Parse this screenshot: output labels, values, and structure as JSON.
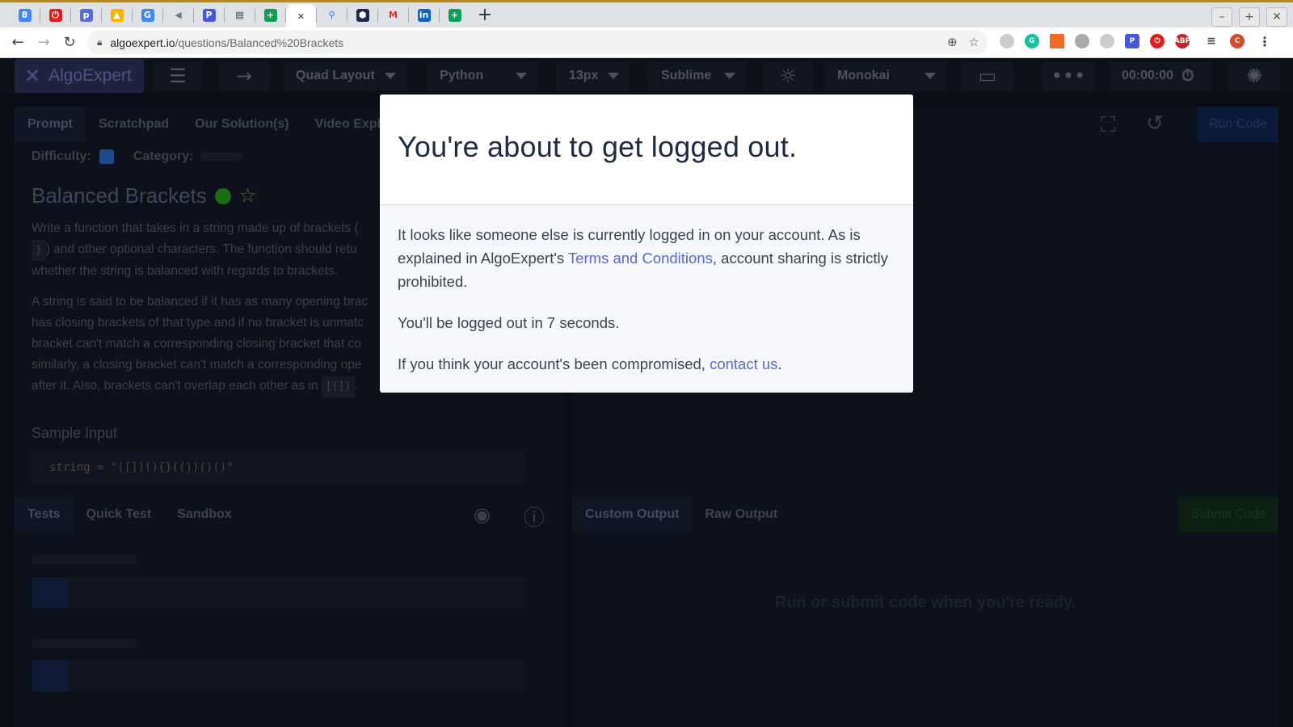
{
  "browser": {
    "tabs": [
      {
        "icon": "calendar-icon",
        "glyph": "8",
        "color": "#4285f4"
      },
      {
        "icon": "opera-icon",
        "glyph": "⏻",
        "color": "#e02020"
      },
      {
        "icon": "p-icon",
        "glyph": "p",
        "color": "#5a6ad8"
      },
      {
        "icon": "drive-icon",
        "glyph": "▲",
        "color": "#f4b400"
      },
      {
        "icon": "google-icon",
        "glyph": "G",
        "color": "#4285f4"
      },
      {
        "icon": "audio-icon",
        "glyph": "◀",
        "color": "#777"
      },
      {
        "icon": "p-square-icon",
        "glyph": "P",
        "color": "#4856d8"
      },
      {
        "icon": "terminal-icon",
        "glyph": "▤",
        "color": "#333"
      },
      {
        "icon": "sheets-icon",
        "glyph": "+",
        "color": "#0f9d58"
      },
      {
        "icon": "algoexpert-icon",
        "glyph": "✕",
        "color": "#333"
      },
      {
        "icon": "search-tab-icon",
        "glyph": "⚲",
        "color": "#2a7ad8"
      },
      {
        "icon": "hexagon-icon",
        "glyph": "⬢",
        "color": "#1a2a4a"
      },
      {
        "icon": "gmail-icon",
        "glyph": "M",
        "color": "#d93025"
      },
      {
        "icon": "linkedin-icon",
        "glyph": "in",
        "color": "#0a66c2"
      },
      {
        "icon": "sheets-icon-2",
        "glyph": "+",
        "color": "#0f9d58"
      }
    ],
    "url_domain": "algoexpert.io",
    "url_path": "/questions/Balanced%20Brackets"
  },
  "app": {
    "logo_text": "AlgoExpert",
    "layout_select": "Quad Layout",
    "language_select": "Python",
    "font_size_select": "13px",
    "keymap_select": "Sublime",
    "theme_select": "Monokai",
    "timer": "00:00:00",
    "prompt_tabs": [
      "Prompt",
      "Scratchpad",
      "Our Solution(s)",
      "Video Expl"
    ],
    "run_code_label": "Run Code",
    "difficulty_label": "Difficulty:",
    "category_label": "Category:",
    "question_title": "Balanced Brackets",
    "para1": "Write a function that takes in a string made up of brackets (",
    "para1b": ") and other optional characters. The function should retu",
    "para1c": "whether the string is balanced with regards to brackets.",
    "para2a": "A string is said to be balanced if it has as many opening brac",
    "para2b": "has closing brackets of that type and if no bracket is unmatc",
    "para2c": "bracket can't match a corresponding closing bracket that co",
    "para2d": "similarly, a closing bracket can't match a corresponding ope",
    "para2e": "after it. Also, brackets can't overlap each other as in",
    "code_chip_1": "}",
    "code_chip_2": "[(])",
    "sample_input_label": "Sample Input",
    "sample_input_code": "string = \"([])(){}(())()()\"",
    "test_tabs": [
      "Tests",
      "Quick Test",
      "Sandbox"
    ],
    "output_tabs": [
      "Custom Output",
      "Raw Output"
    ],
    "submit_code_label": "Submit Code",
    "output_placeholder": "Run or submit code when you're ready."
  },
  "modal": {
    "title": "You're about to get logged out.",
    "body1_a": "It looks like someone else is currently logged in on your account. As is explained in AlgoExpert's ",
    "body1_link": "Terms and Conditions",
    "body1_b": ", account sharing is strictly prohibited.",
    "body2": "You'll be logged out in 7 seconds.",
    "body3_a": "If you think your account's been compromised, ",
    "body3_link": "contact us",
    "body3_b": "."
  }
}
